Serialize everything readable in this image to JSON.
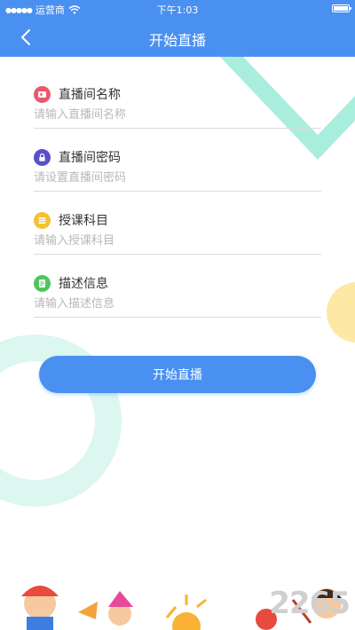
{
  "status_bar": {
    "carrier": "运营商",
    "time": "下午1:03"
  },
  "nav": {
    "title": "开始直播"
  },
  "form": {
    "fields": [
      {
        "label": "直播间名称",
        "placeholder": "请输入直播间名称",
        "icon": "video-icon",
        "color": "#e9596a"
      },
      {
        "label": "直播间密码",
        "placeholder": "请设置直播间密码",
        "icon": "lock-icon",
        "color": "#5b4fc9"
      },
      {
        "label": "授课科目",
        "placeholder": "请输入授课科目",
        "icon": "list-icon",
        "color": "#f2c230"
      },
      {
        "label": "描述信息",
        "placeholder": "请输入描述信息",
        "icon": "document-icon",
        "color": "#4ec65b"
      }
    ]
  },
  "start_button": {
    "label": "开始直播"
  },
  "watermark": "2265"
}
